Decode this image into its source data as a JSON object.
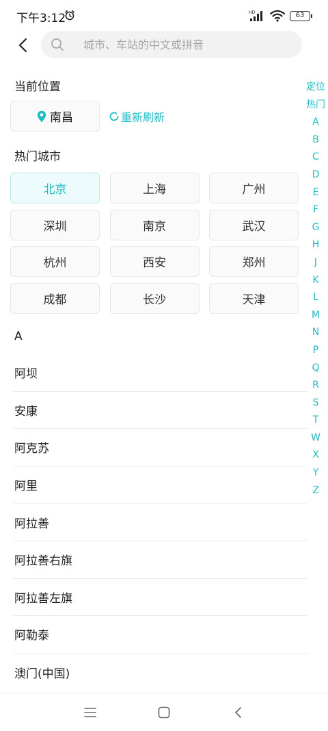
{
  "status_bar": {
    "time": "下午3:12",
    "network_label": "HD",
    "battery": "63"
  },
  "search": {
    "placeholder": "城市、车站的中文或拼音",
    "value": ""
  },
  "current_location": {
    "title": "当前位置",
    "city": "南昌",
    "refresh_label": "重新刷新"
  },
  "hot_cities": {
    "title": "热门城市",
    "selected": "北京",
    "items": [
      "北京",
      "上海",
      "广州",
      "深圳",
      "南京",
      "武汉",
      "杭州",
      "西安",
      "郑州",
      "成都",
      "长沙",
      "天津"
    ]
  },
  "city_list": {
    "letter": "A",
    "items": [
      "阿坝",
      "安康",
      "阿克苏",
      "阿里",
      "阿拉善",
      "阿拉善右旗",
      "阿拉善左旗",
      "阿勒泰",
      "澳门(中国)"
    ]
  },
  "index_bar": [
    "定位",
    "热门",
    "A",
    "B",
    "C",
    "D",
    "E",
    "F",
    "G",
    "H",
    "J",
    "K",
    "L",
    "M",
    "N",
    "P",
    "Q",
    "R",
    "S",
    "T",
    "W",
    "X",
    "Y",
    "Z"
  ],
  "colors": {
    "accent": "#1dbcc4",
    "chip_bg": "#fafafa",
    "selected_bg": "#eefbfc",
    "divider": "#ececec"
  },
  "icons": {
    "back": "chevron-left-icon",
    "search": "search-icon",
    "pin": "location-pin-icon",
    "refresh": "refresh-icon",
    "alarm": "alarm-clock-icon",
    "signal": "signal-icon",
    "wifi": "wifi-icon",
    "battery": "battery-icon"
  }
}
